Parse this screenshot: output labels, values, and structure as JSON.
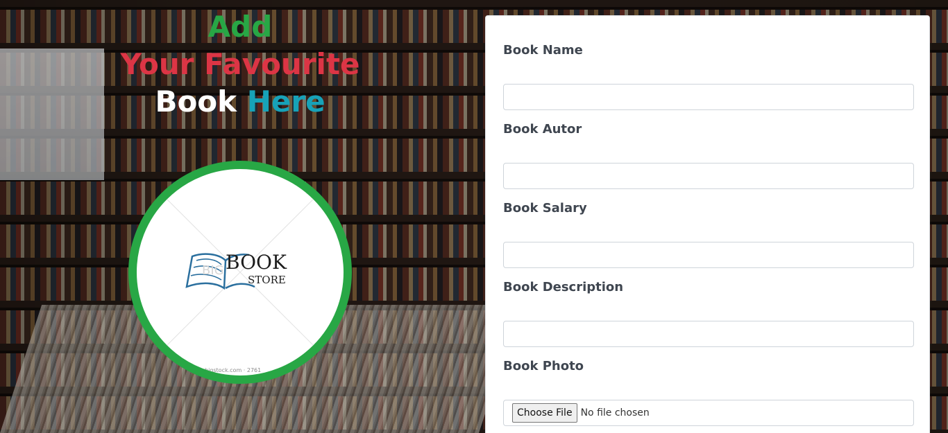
{
  "headline": {
    "line1": "Add",
    "line2": "Your Favourite",
    "line3_word1": "Book",
    "line3_word2": "Here"
  },
  "logo": {
    "word_book": "BOOK",
    "word_store": "STORE",
    "credit": "bigstock.com · 2761"
  },
  "form": {
    "fields": [
      {
        "label": "Book Name",
        "value": ""
      },
      {
        "label": "Book Autor",
        "value": ""
      },
      {
        "label": "Book Salary",
        "value": ""
      },
      {
        "label": "Book Description",
        "value": ""
      },
      {
        "label": "Book Photo",
        "button": "Choose File",
        "status": "No file chosen"
      }
    ]
  },
  "colors": {
    "green": "#28a745",
    "red": "#dc3545",
    "teal": "#17a2b8",
    "white": "#ffffff"
  }
}
